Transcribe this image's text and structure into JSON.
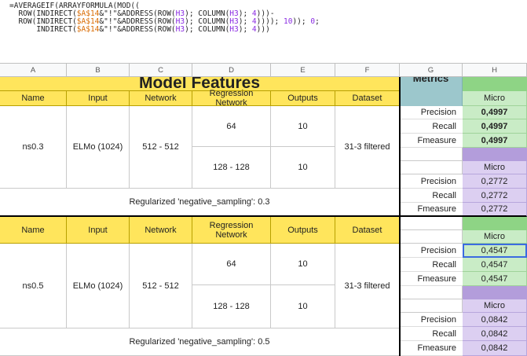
{
  "formula": {
    "line1": "=AVERAGEIF(ARRAYFORMULA(MOD((",
    "line2a": "  ROW(INDIRECT(",
    "ref_a": "$A$14",
    "line2b": "&\"!\"&ADDRESS(ROW(",
    "ref_h": "H3",
    "line2c": "); COLUMN(",
    "line2d": "); ",
    "num4": "4",
    "line2e": ")))-",
    "line3a": "  ROW(INDIRECT(",
    "line3e": ")))); ",
    "num10": "10",
    "line3f": ")); ",
    "num0": "0",
    "line3g": ";",
    "line4a": "      INDIRECT(",
    "line4e": ")))"
  },
  "columns": [
    "A",
    "B",
    "C",
    "D",
    "E",
    "F",
    "G",
    "H"
  ],
  "title": "Model Features",
  "metrics_title": "Metrics",
  "headers": [
    "Name",
    "Input",
    "Network",
    "Regression Network",
    "Outputs",
    "Dataset"
  ],
  "blocks": [
    {
      "name": "ns0.3",
      "input": "ELMo (1024)",
      "network": "512 - 512",
      "regression": [
        "64",
        "128 - 128"
      ],
      "outputs": [
        "10",
        "10"
      ],
      "dataset": "31-3 filtered",
      "note": "Regularized 'negative_sampling': 0.3",
      "green": {
        "label": "Micro",
        "rows": [
          {
            "metric": "Precision",
            "value": "0,4997"
          },
          {
            "metric": "Recall",
            "value": "0,4997"
          },
          {
            "metric": "Fmeasure",
            "value": "0,4997"
          }
        ]
      },
      "purple": {
        "label": "Micro",
        "rows": [
          {
            "metric": "Precision",
            "value": "0,2772"
          },
          {
            "metric": "Recall",
            "value": "0,2772"
          },
          {
            "metric": "Fmeasure",
            "value": "0,2772"
          }
        ]
      }
    },
    {
      "name": "ns0.5",
      "input": "ELMo (1024)",
      "network": "512 - 512",
      "regression": [
        "64",
        "128 - 128"
      ],
      "outputs": [
        "10",
        "10"
      ],
      "dataset": "31-3 filtered",
      "note": "Regularized 'negative_sampling': 0.5",
      "green": {
        "label": "Micro",
        "rows": [
          {
            "metric": "Precision",
            "value": "0,4547"
          },
          {
            "metric": "Recall",
            "value": "0,4547"
          },
          {
            "metric": "Fmeasure",
            "value": "0,4547"
          }
        ]
      },
      "purple": {
        "label": "Micro",
        "rows": [
          {
            "metric": "Precision",
            "value": "0,0842"
          },
          {
            "metric": "Recall",
            "value": "0,0842"
          },
          {
            "metric": "Fmeasure",
            "value": "0,0842"
          }
        ]
      }
    }
  ],
  "colors": {
    "header_yellow": "#ffe55c",
    "green_band": "#8ed485",
    "green_cell": "#c9ecc6",
    "purple_band": "#b39ddb",
    "purple_cell": "#dccff1",
    "metrics_header": "#9cc7cc",
    "selection": "#3b6be0"
  }
}
